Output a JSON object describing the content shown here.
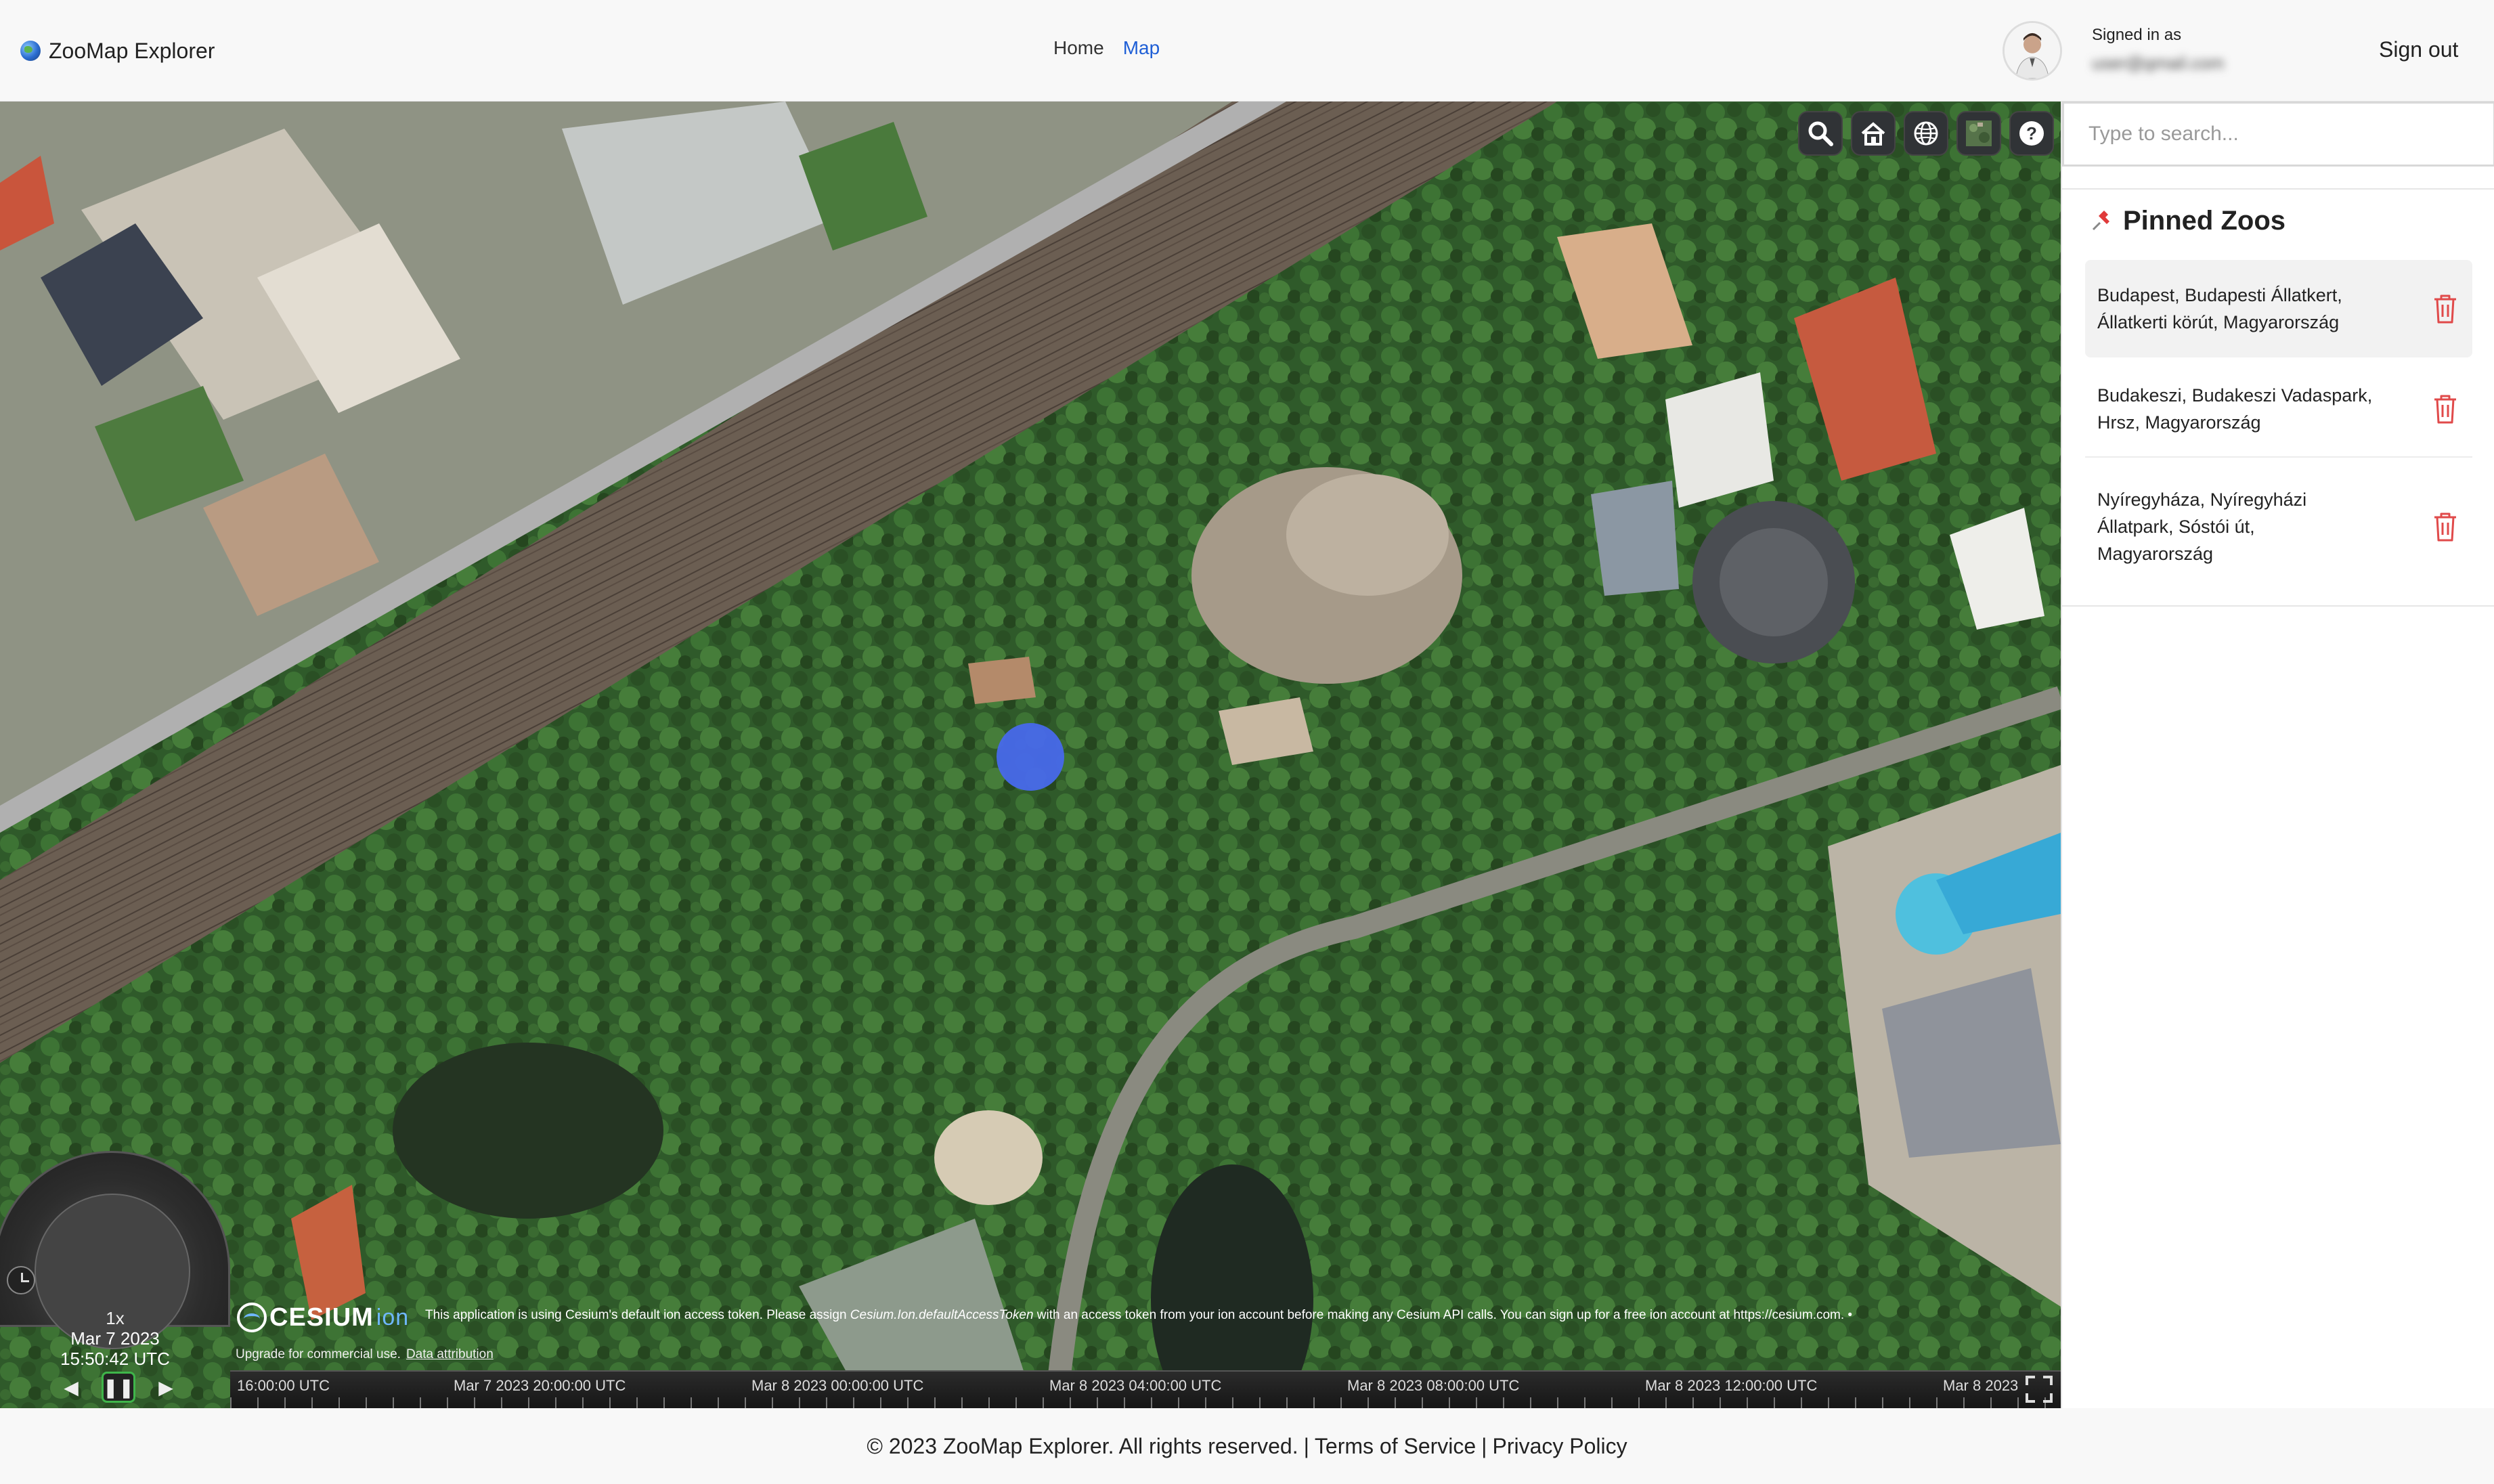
{
  "header": {
    "brand": "ZooMap Explorer",
    "nav": [
      {
        "label": "Home",
        "active": false
      },
      {
        "label": "Map",
        "active": true
      }
    ],
    "signed_in_label": "Signed in as",
    "signed_in_email": "user@gmail.com",
    "sign_out": "Sign out"
  },
  "toolbar": {
    "icons": [
      "search-icon",
      "home-icon",
      "globe-icon",
      "imagery-layer-icon",
      "help-icon"
    ]
  },
  "map": {
    "marker_color": "#4769e8"
  },
  "cesium": {
    "logo_text": "CESIUM",
    "logo_suffix": "ion",
    "notice_prefix": "This application is using Cesium's default ion access token. Please assign ",
    "notice_code": "Cesium.Ion.defaultAccessToken",
    "notice_suffix": " with an access token from your ion account before making any Cesium API calls. You can sign up for a free ion account at https://cesium.com. •",
    "upgrade_text": "Upgrade for commercial use.",
    "data_attribution": "Data attribution",
    "animation": {
      "speed": "1x",
      "date": "Mar 7 2023",
      "time": "15:50:42 UTC"
    },
    "timeline_labels": [
      "16:00:00 UTC",
      "Mar 7 2023 20:00:00 UTC",
      "Mar 8 2023 00:00:00 UTC",
      "Mar 8 2023 04:00:00 UTC",
      "Mar 8 2023 08:00:00 UTC",
      "Mar 8 2023 12:00:00 UTC",
      "Mar 8 2023"
    ]
  },
  "sidebar": {
    "search_placeholder": "Type to search...",
    "pinned_title": "Pinned Zoos",
    "zoos": [
      {
        "line1": "Budapest, Budapesti Állatkert,",
        "line2": "Állatkerti körút, Magyarország",
        "line3": "",
        "selected": true
      },
      {
        "line1": "Budakeszi, Budakeszi Vadaspark,",
        "line2": "Hrsz, Magyarország",
        "line3": "",
        "selected": false
      },
      {
        "line1": "Nyíregyháza, Nyíregyházi",
        "line2": "Állatpark, Sóstói út,",
        "line3": "Magyarország",
        "selected": false
      }
    ]
  },
  "footer": {
    "copyright": "© 2023 ZooMap Explorer. All rights reserved.",
    "terms": "Terms of Service",
    "privacy": "Privacy Policy",
    "separator": "|"
  },
  "colors": {
    "accent": "#1f5fd6",
    "trash": "#e04a4a",
    "marker": "#4769e8",
    "play_border": "#3fb54a"
  }
}
